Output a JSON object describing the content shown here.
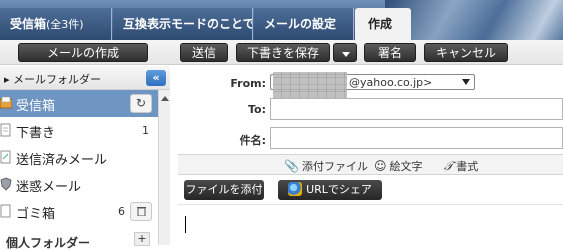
{
  "tabs": [
    {
      "label": "受信箱",
      "count": "(全3件)",
      "active": false
    },
    {
      "label": "互換表示モードのことで",
      "count": "",
      "active": false
    },
    {
      "label": "メールの設定",
      "count": "",
      "active": false
    },
    {
      "label": "作成",
      "count": "",
      "active": true
    }
  ],
  "toolbar": {
    "compose": "メールの作成",
    "send": "送信",
    "save_draft": "下書きを保存",
    "signature": "署名",
    "cancel": "キャンセル"
  },
  "sidebar": {
    "header": "メールフォルダー",
    "collapse_glyph": "«",
    "folders": [
      {
        "name": "受信箱",
        "count": "",
        "selected": true
      },
      {
        "name": "下書き",
        "count": "1",
        "selected": false
      },
      {
        "name": "送信済みメール",
        "count": "",
        "selected": false
      },
      {
        "name": "迷惑メール",
        "count": "",
        "selected": false
      },
      {
        "name": "ゴミ箱",
        "count": "6",
        "selected": false
      }
    ],
    "personal_folders": "個人フォルダー",
    "refresh_glyph": "↻",
    "add_glyph": "+"
  },
  "compose": {
    "from_label": "From:",
    "from_value": "@yahoo.co.jp>",
    "to_label": "To:",
    "subject_label": "件名:",
    "attach_tab": "添付ファイル",
    "emoji_tab": "絵文字",
    "format_tab": "書式",
    "attach_button": "ファイルを添付",
    "url_share_button": "URLでシェア"
  },
  "colors": {
    "tab_bar": "#37557e",
    "selected_folder": "#6f95c2",
    "collapse_button": "#2f6fbf",
    "dark_button": "#2e2e2e"
  }
}
